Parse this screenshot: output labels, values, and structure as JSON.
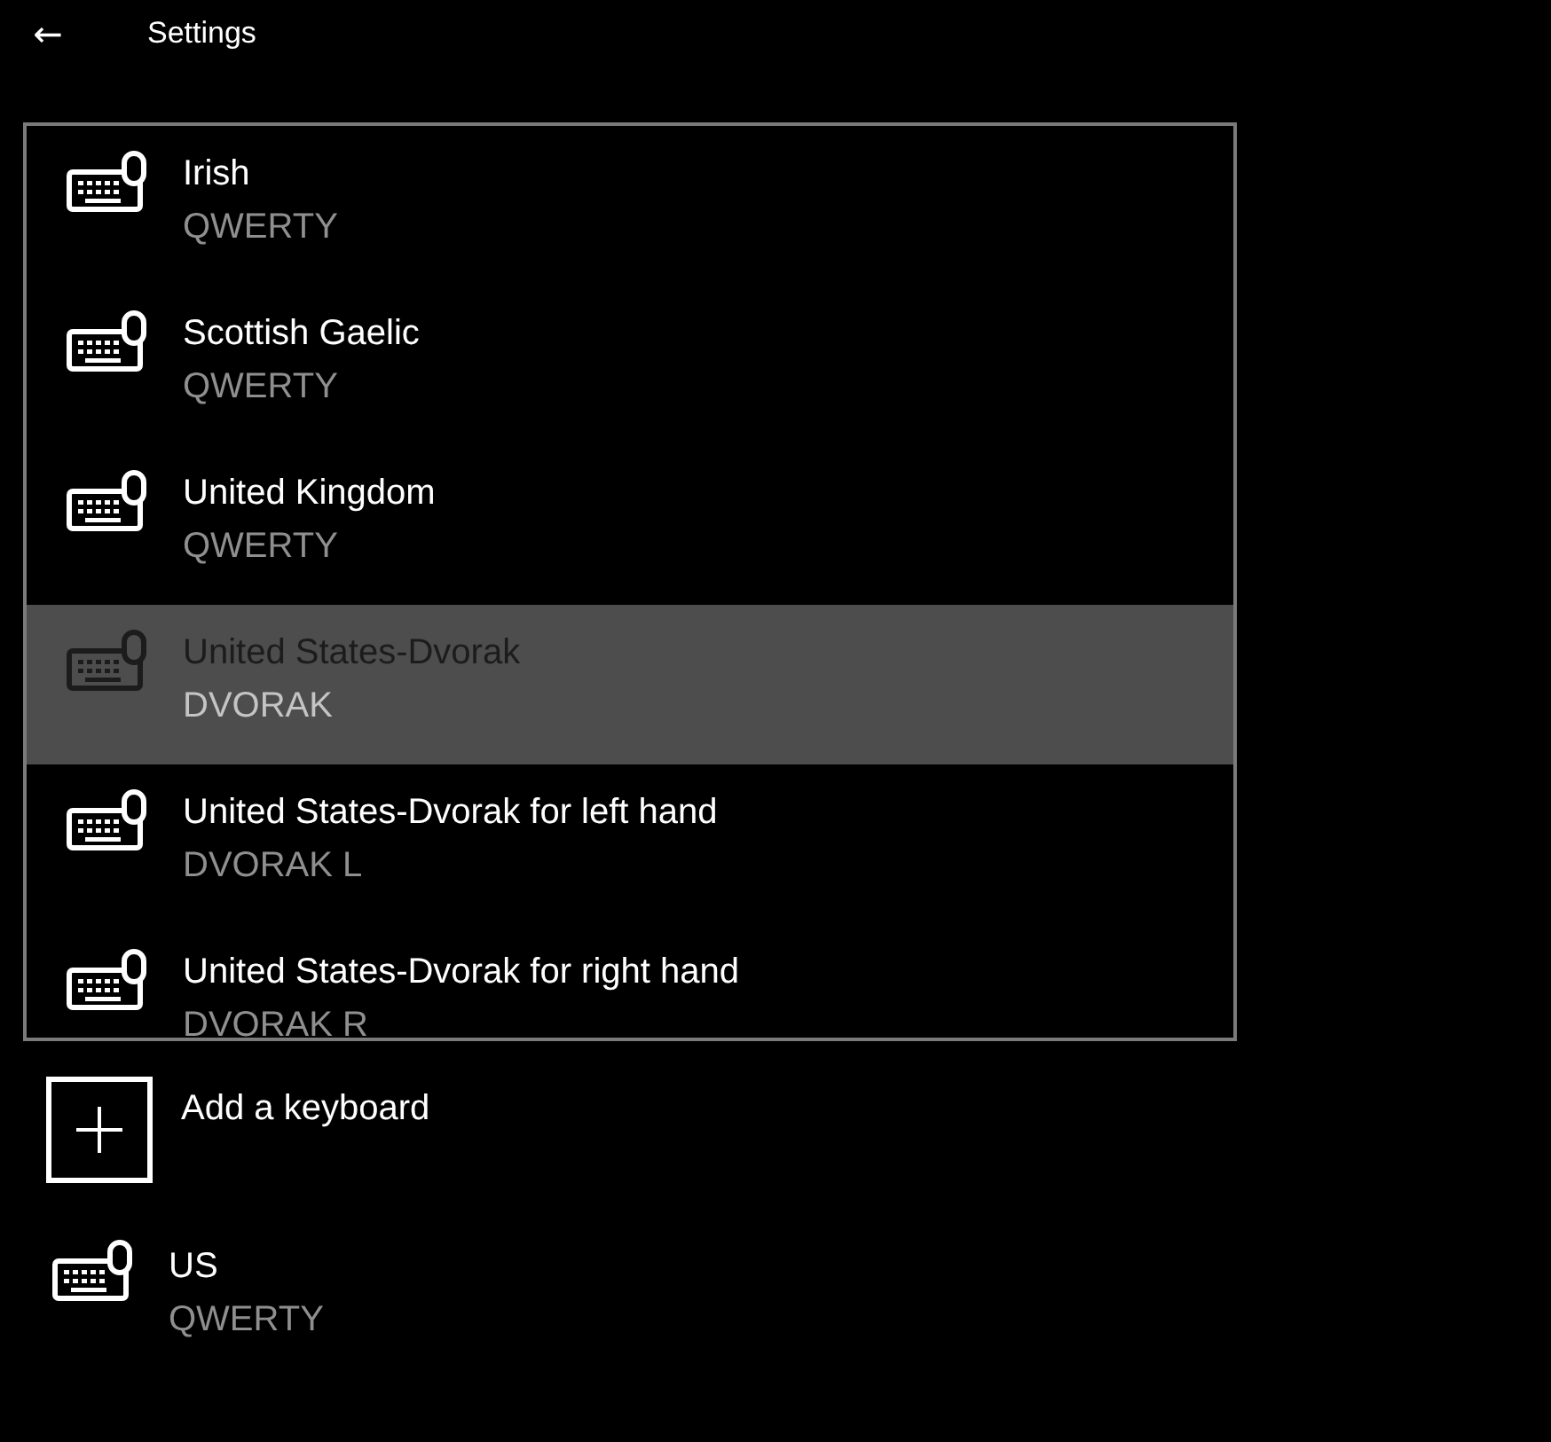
{
  "header": {
    "back_icon": "←",
    "title": "Settings"
  },
  "keyboards": [
    {
      "name": "Irish",
      "layout": "QWERTY",
      "selected": false
    },
    {
      "name": "Scottish Gaelic",
      "layout": "QWERTY",
      "selected": false
    },
    {
      "name": "United Kingdom",
      "layout": "QWERTY",
      "selected": false
    },
    {
      "name": "United States-Dvorak",
      "layout": "DVORAK",
      "selected": true
    },
    {
      "name": "United States-Dvorak for left hand",
      "layout": "DVORAK L",
      "selected": false
    },
    {
      "name": "United States-Dvorak for right hand",
      "layout": "DVORAK R",
      "selected": false
    }
  ],
  "add_keyboard": {
    "label": "Add a keyboard"
  },
  "installed": [
    {
      "name": "US",
      "layout": "QWERTY"
    }
  ]
}
